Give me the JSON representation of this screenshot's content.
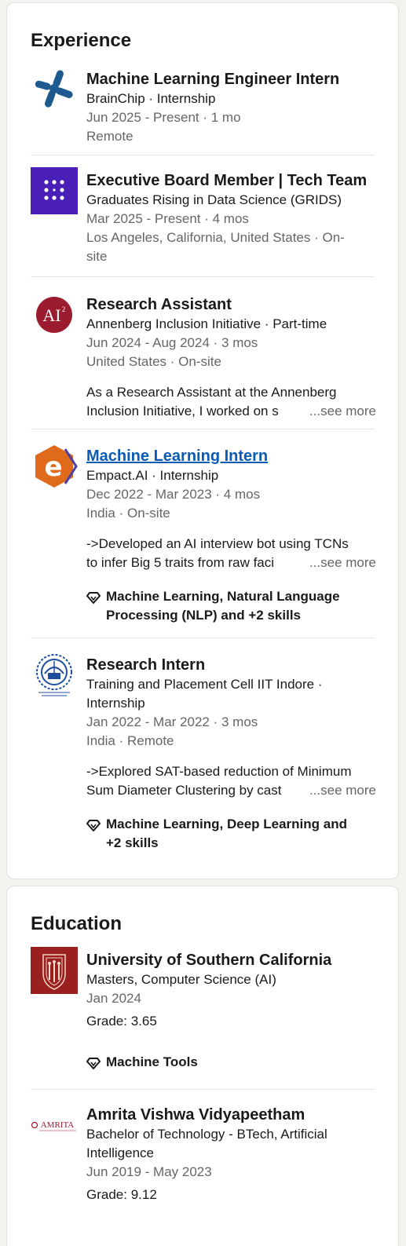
{
  "experience": {
    "title": "Experience",
    "items": [
      {
        "logo": "brainchip-logo",
        "title": "Machine Learning Engineer Intern",
        "company": "BrainChip · Internship",
        "dates": "Jun 2025 - Present · 1 mo",
        "location": "Remote"
      },
      {
        "logo": "grids-logo",
        "title": "Executive Board Member | Tech Team",
        "company": "Graduates Rising in Data Science (GRIDS)",
        "dates": "Mar 2025 - Present · 4 mos",
        "location_line1": "Los Angeles, California, United States · On-",
        "location_line2": "site"
      },
      {
        "logo": "annenberg-ai-logo",
        "logo_text": "AI",
        "logo_sup": "2",
        "title": "Research Assistant",
        "company": "Annenberg Inclusion Initiative · Part-time",
        "dates": "Jun 2024 - Aug 2024 · 3 mos",
        "location": "United States · On-site",
        "desc_line1": "As a Research Assistant at the Annenberg",
        "desc_line2": "Inclusion Initiative, I worked on s",
        "see_more": "...see more"
      },
      {
        "logo": "empact-ai-logo",
        "logo_text": "e",
        "title": "Machine Learning Intern",
        "company": "Empact.AI · Internship",
        "dates": "Dec 2022 - Mar 2023 · 4 mos",
        "location": "India · On-site",
        "desc_line1": "->Developed an AI interview bot using TCNs",
        "desc_line2": "to infer Big 5 traits from raw faci",
        "see_more": "...see more",
        "skills_line1": "Machine Learning, Natural Language",
        "skills_line2": "Processing (NLP) and +2 skills"
      },
      {
        "logo": "iit-indore-logo",
        "title": "Research Intern",
        "company_line1": "Training and Placement Cell IIT Indore ·",
        "company_line2": "Internship",
        "dates": "Jan 2022 - Mar 2022 · 3 mos",
        "location": "India · Remote",
        "desc_line1": "->Explored SAT-based reduction of Minimum",
        "desc_line2": "Sum Diameter Clustering by cast",
        "see_more": "...see more",
        "skills_line1": "Machine Learning, Deep Learning and",
        "skills_line2": "+2 skills"
      }
    ]
  },
  "education": {
    "title": "Education",
    "items": [
      {
        "logo": "usc-logo",
        "school": "University of Southern California",
        "degree": "Masters, Computer Science (AI)",
        "dates": "Jan 2024",
        "grade": "Grade: 3.65",
        "skills": "Machine Tools"
      },
      {
        "logo": "amrita-logo",
        "logo_text": "AMRITA",
        "school": "Amrita Vishwa Vidyapeetham",
        "degree_line1": "Bachelor of Technology - BTech, Artificial",
        "degree_line2": "Intelligence",
        "dates": "Jun 2019 - May 2023",
        "grade": "Grade: 9.12"
      }
    ]
  },
  "colors": {
    "link": "#0a5bb5",
    "muted": "#666666",
    "background": "#f4f2ee",
    "grids_purple": "#4a1fb8",
    "usc_red": "#9a1f1f",
    "empact_orange": "#e06a1b"
  }
}
